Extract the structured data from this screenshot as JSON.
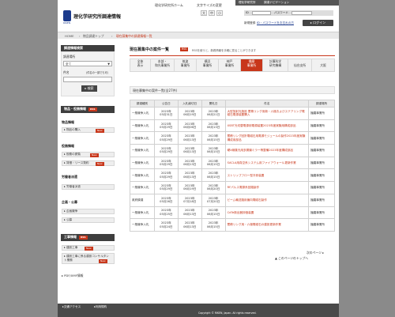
{
  "header": {
    "logo_text": "理化学研究所調達情報",
    "logo_sub": "RIKEN",
    "home_link": "理化学研究所ホーム",
    "font_size_label": "文字サイズの変更",
    "font_sizes": [
      "大",
      "中",
      "小"
    ],
    "corp_bar": {
      "left": "理化学研究所",
      "right": "調達ナビゲーション"
    },
    "login": {
      "id_label": "ID",
      "pw_label": "パスワード",
      "register": "新規登録",
      "forgot": "ID・パスワードをお忘れの方",
      "button": "ログイン"
    }
  },
  "breadcrumb": {
    "items": [
      "HOME",
      "物品調達トップ",
      "現在募集中の調達情報一覧"
    ]
  },
  "sidebar": {
    "search_title": "調達情報検索",
    "place_label": "調達場所",
    "place_value": "全て",
    "keyword_label": "件名",
    "keyword_note": "(件名の一部でも可)",
    "search_button": "検索",
    "goods_title": "物品・役務情報",
    "goods_head": "物品情報",
    "goods_items": [
      "物品の購入"
    ],
    "service_head": "役務情報",
    "service_items": [
      "役務の請負",
      "賃借・リース契約"
    ],
    "labor_head": "労働者派遣",
    "labor_items": [
      "労働者派遣"
    ],
    "bid_head": "企画・公募",
    "bid_items": [
      "企画競争",
      "公募"
    ],
    "works_title": "工事情報",
    "works_items": [
      "建設工事",
      "建設工事に係る建設コンサルタント業務"
    ],
    "pdf": "PDF/XMF情報",
    "new": "New",
    "rss": "RSS"
  },
  "main": {
    "title": "現在募集中の案件一覧",
    "rss": "RSS",
    "rss_note": "RSSを使うと、新着情報を手軽に見ることができます",
    "tabs": [
      "全体\n表示",
      "本部・\n和光事業所",
      "筑波\n事業所",
      "横浜\n事業所",
      "神戸\n事業所",
      "播磨\n事業所",
      "計算科学\n研究機構",
      "仙台支所",
      "大阪"
    ],
    "list_title": "現在募集中の案件一覧(全27件)",
    "columns": [
      "調達種別",
      "公告日",
      "入札締切日",
      "開札日",
      "件名",
      "調達場所"
    ],
    "rows": [
      [
        "一般競争入札",
        "2023年\n05月31日",
        "2023年\n06月19日",
        "2023年\n06月21日",
        "大型放射光施設 蓄積リング用新・六極およびステアリング電磁石電源装置購入",
        "播磨事業所"
      ],
      [
        "一般競争入札",
        "2023年\n05月29日",
        "2023年\n06月06日",
        "2023年\n06月13日",
        "XSBT光切替電源用電源装置2023年度実験用構成部品",
        "播磨事業所"
      ],
      [
        "一般競争入札",
        "2023年\n05月29日",
        "2023年\n06月13日",
        "2023年\n06月15日",
        "蓄積リング回折電磁石用電源モジュールの製作2023年度実験構成用部品",
        "播磨事業所"
      ],
      [
        "一般競争入札",
        "2023年\n05月29日",
        "2023年\n06月13日",
        "2023年\n06月15日",
        "硬X線集光用多層膜ミラー等整備2023年度構成部品",
        "播磨事業所"
      ],
      [
        "一般競争入札",
        "2023年\n05月29日",
        "2023年\n06月13日",
        "2023年\n06月15日",
        "SACLA用真空系システム用ファイアウォール更新作業",
        "播磨事業所"
      ],
      [
        "一般競争入札",
        "2023年\n05月29日",
        "2023年\n06月13日",
        "2023年\n06月15日",
        "ストリップフロー型冷却装置",
        "播磨事業所"
      ],
      [
        "一般競争入札",
        "2023年\n05月29日",
        "2023年\n06月19日",
        "2023年\n06月20日",
        "RFパルス電源系回路製作",
        "播磨事業所"
      ],
      [
        "政府調達",
        "2023年\n05月26日",
        "2023年\n07月18日",
        "2023年\n07月20日",
        "ビーム輸送路用偏向電磁石製作",
        "播磨事業所"
      ],
      [
        "一般競争入札",
        "2023年\n05月25日",
        "2023年\n06月13日",
        "2023年\n06月15日",
        "CdTe検出器評価装置",
        "播磨事業所"
      ],
      [
        "一般競争入札",
        "2023年\n05月24日",
        "2023年\n06月13日",
        "2023年\n06月15日",
        "蓄積リング用・六極電磁石の建設更新作業",
        "播磨事業所"
      ]
    ],
    "next_link": "次のページ",
    "top_link": "このページのトップへ"
  },
  "footer": {
    "links": [
      "交通アクセス",
      "利用規約"
    ],
    "copyright": "Copyright © RIKEN, Japan. All rights reserved."
  }
}
